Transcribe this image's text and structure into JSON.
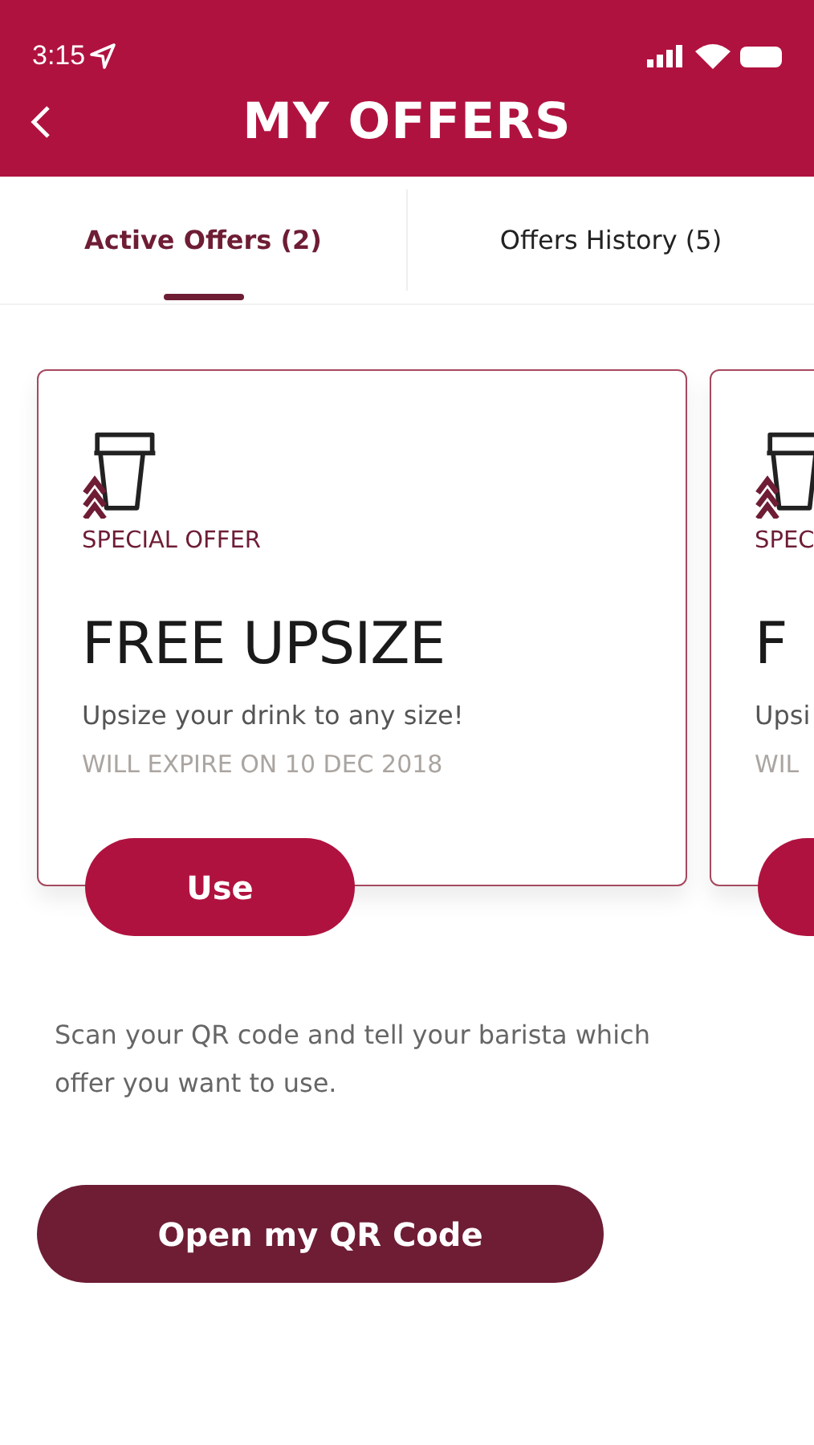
{
  "status_bar": {
    "time": "3:15"
  },
  "header": {
    "title": "MY OFFERS"
  },
  "tabs": [
    {
      "label": "Active Offers (2)",
      "selected": true
    },
    {
      "label": "Offers History (5)",
      "selected": false
    }
  ],
  "offers": [
    {
      "tag": "SPECIAL OFFER",
      "title": "FREE UPSIZE",
      "description": "Upsize your drink to any size!",
      "expiry": "WILL EXPIRE ON 10 DEC 2018",
      "button": "Use"
    },
    {
      "tag": "SPEC",
      "title": "F",
      "description": "Upsi",
      "expiry": "WIL"
    }
  ],
  "instructions": "Scan your QR code and tell your barista which offer you want to use.",
  "qr_button": "Open my QR Code"
}
